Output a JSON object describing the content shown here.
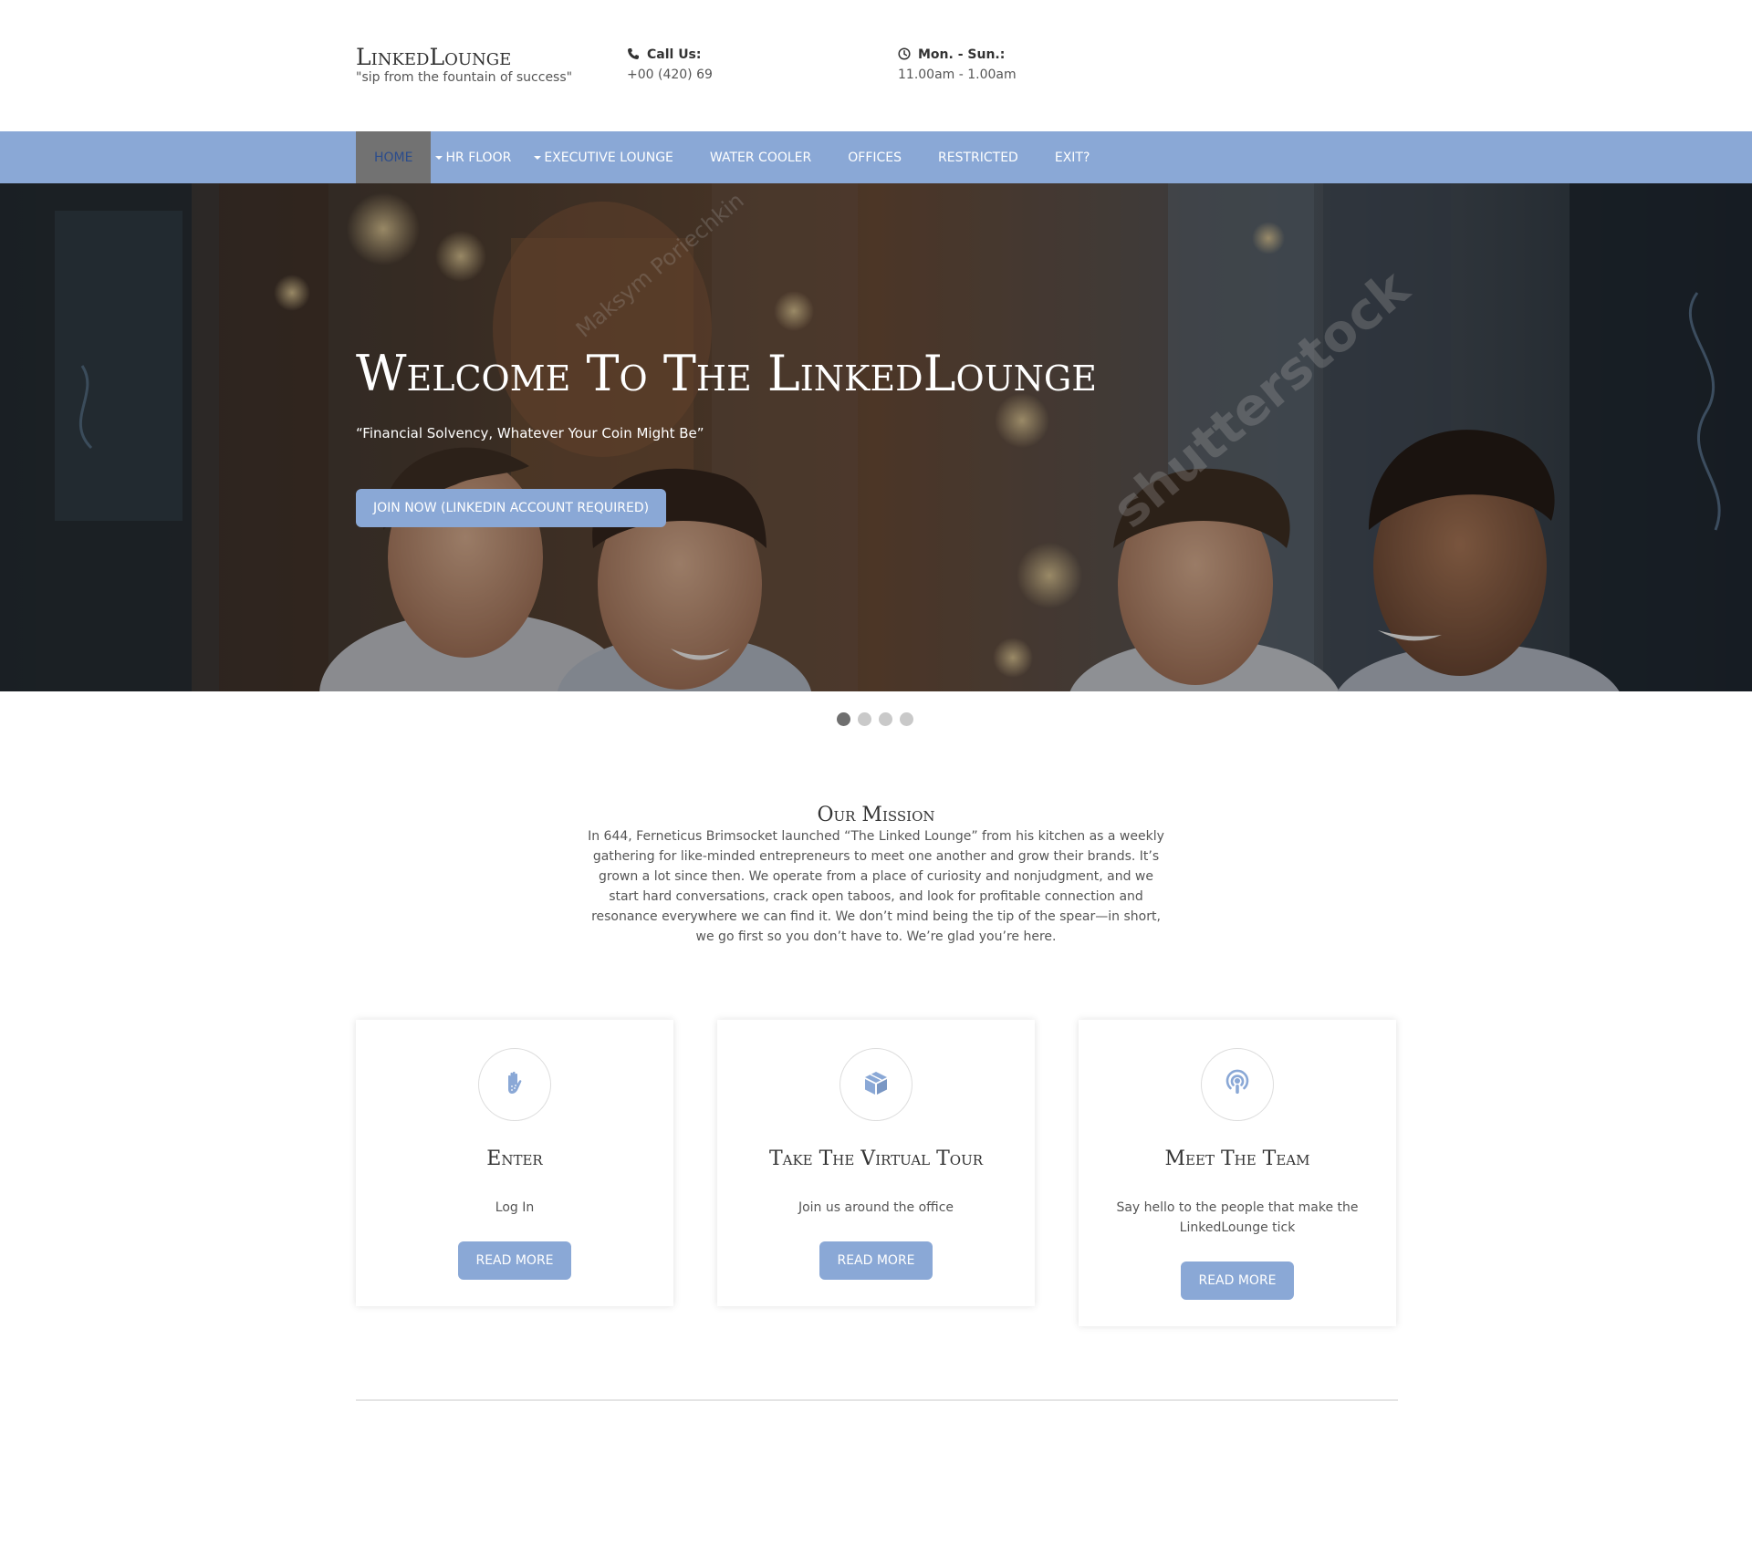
{
  "header": {
    "logo_name": "LinkedLounge",
    "logo_tagline": "\"sip from the fountain of success\"",
    "call": {
      "label": "Call Us:",
      "value": "+00 (420) 69",
      "icon": "phone-icon"
    },
    "hours": {
      "label": "Mon. - Sun.:",
      "value": "11.00am - 1.00am",
      "icon": "clock-icon"
    }
  },
  "nav": {
    "items": [
      {
        "label": "Home",
        "active": true,
        "dropdown": false
      },
      {
        "label": "HR Floor",
        "active": false,
        "dropdown": true
      },
      {
        "label": "Executive Lounge",
        "active": false,
        "dropdown": true
      },
      {
        "label": "Water Cooler",
        "active": false,
        "dropdown": false
      },
      {
        "label": "Offices",
        "active": false,
        "dropdown": false
      },
      {
        "label": "Restricted",
        "active": false,
        "dropdown": false
      },
      {
        "label": "Exit?",
        "active": false,
        "dropdown": false
      }
    ]
  },
  "hero": {
    "title": "Welcome To The LinkedLounge",
    "subtitle": "“Financial Solvency, Whatever Your Coin Might Be”",
    "cta_label": "Join Now (LinkedIn Account Required)",
    "watermark_1": "shutterstock",
    "watermark_2": "Maksym Poriechkin"
  },
  "carousel": {
    "slide_count": 4,
    "active_index": 0
  },
  "mission": {
    "title": "Our Mission",
    "text": "In 644, Ferneticus Brimsocket launched “The Linked Lounge” from his kitchen as a weekly gathering for like-minded entrepreneurs to meet one another and grow their brands. It’s grown a lot since then. We operate from a place of curiosity and nonjudgment, and we start hard conversations, crack open taboos, and look for profitable connection and resonance everywhere we can find it. We don’t mind being the tip of the spear—in short, we go first so you don’t have to. We’re glad you’re here."
  },
  "cards": [
    {
      "icon": "hand-icon",
      "title": "Enter",
      "description": "Log In",
      "button": "Read More"
    },
    {
      "icon": "cube-icon",
      "title": "Take The Virtual Tour",
      "description": "Join us around the office",
      "button": "Read More"
    },
    {
      "icon": "podcast-icon",
      "title": "Meet The Team",
      "description": "Say hello to the people that make the LinkedLounge tick",
      "button": "Read More"
    }
  ],
  "colors": {
    "accent": "#8aa8d6",
    "nav_active_bg": "#727272",
    "nav_active_text": "#2b4c8c",
    "heading": "#333333",
    "body_text": "#555555"
  }
}
